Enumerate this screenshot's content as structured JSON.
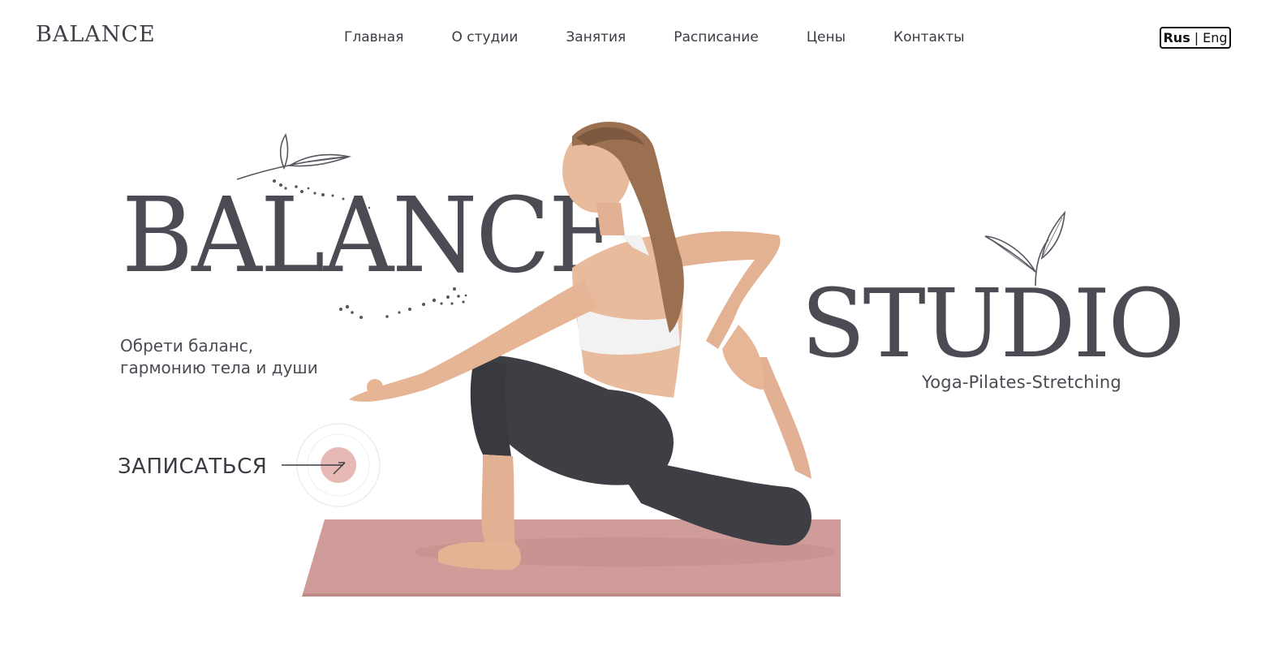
{
  "header": {
    "logo": "BALANCE",
    "nav": [
      {
        "label": "Главная"
      },
      {
        "label": "О студии"
      },
      {
        "label": "Занятия"
      },
      {
        "label": "Расписание"
      },
      {
        "label": "Цены"
      },
      {
        "label": "Контакты"
      }
    ],
    "lang": {
      "rus": "Rus",
      "sep": "|",
      "eng": "Eng",
      "active": "Rus"
    }
  },
  "hero": {
    "title_left": "BALANCE",
    "title_right": "STUDIO",
    "subtitle": "Yoga-Pilates-Stretching",
    "tagline": [
      "Обрети баланс,",
      "гармонию тела и души"
    ],
    "cta_label": "ЗАПИСАТЬСЯ",
    "image_subject": "woman-yoga-pose-on-mat",
    "colors": {
      "text": "#4a4b53",
      "accent": "#e7b9b6",
      "mat": "#cf9c9a",
      "leggings": "#3d3f45",
      "top": "#f2f2f2",
      "skin": "#e8bb9c"
    },
    "icons": {
      "leaf_left": "leaf-sprig-icon",
      "leaf_right": "leaf-sprig-icon",
      "cta_arrow": "arrow-icon"
    }
  }
}
